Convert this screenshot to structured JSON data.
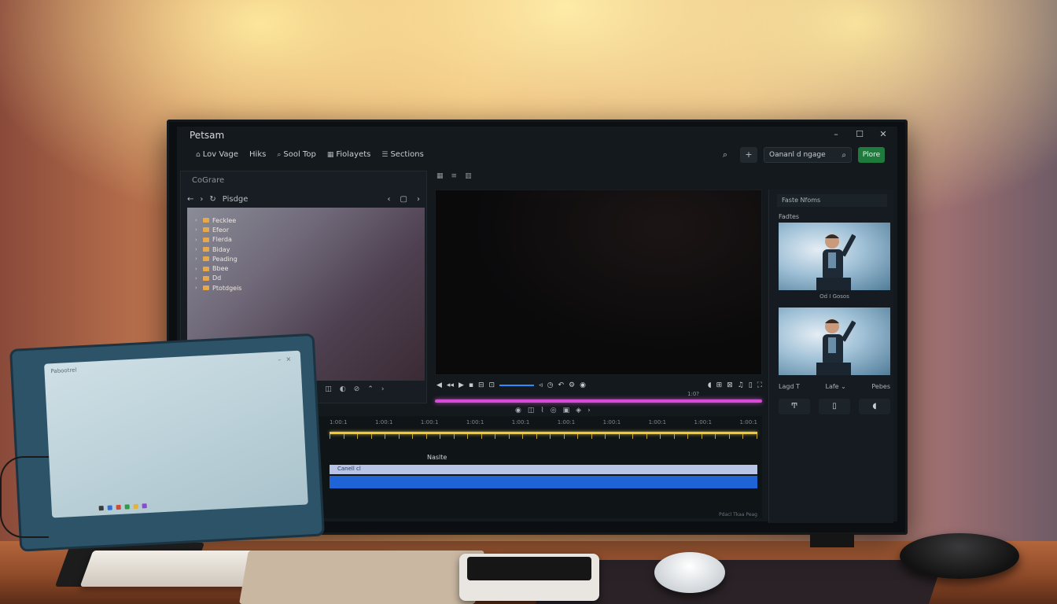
{
  "app": {
    "title": "Petsam",
    "window_controls": [
      "–",
      "☐",
      "✕"
    ]
  },
  "toolbar": {
    "menu": [
      {
        "icon": "home-icon",
        "glyph": "⌂",
        "label": "Lov Vage"
      },
      {
        "icon": "",
        "glyph": "",
        "label": "Hiks"
      },
      {
        "icon": "search-icon",
        "glyph": "⌕",
        "label": "Sool Top"
      },
      {
        "icon": "grid-icon",
        "glyph": "▦",
        "label": "Fiolayets"
      },
      {
        "icon": "sections-icon",
        "glyph": "☰",
        "label": "Sections"
      }
    ],
    "search_value": "Oananl d ngage",
    "primary_button": "Plore"
  },
  "left_panel": {
    "header": "CoGrare",
    "path": "Pisdge",
    "tree": [
      "Fecklee",
      "Efeor",
      "Flerda",
      "Biday",
      "Peading",
      "Bbee",
      "Dd",
      "Ptotdgeis"
    ]
  },
  "right_panel": {
    "header": "Faste Nfoms",
    "subheader": "Fadtes",
    "thumb1_caption": "Od I Gosos",
    "labels": [
      "Lagd T",
      "Lafe ⌄",
      "Pebes"
    ],
    "buttons": [
      "Ͳ",
      "▯",
      "◖"
    ]
  },
  "viewer": {
    "time_label": "1:0?"
  },
  "timeline": {
    "ruler": [
      "1:00:1",
      "1:00:1",
      "1:00:1",
      "1:00:1",
      "1:00:1",
      "1:00:1",
      "1:00:1",
      "1:00:1",
      "1:00:1",
      "1:00:1"
    ],
    "track_label": "Naslte",
    "clip_label": "Canell cl",
    "footer_right": "Pdacl Tkaa Peag"
  },
  "laptop": {
    "title": "Pabootrel"
  },
  "colors": {
    "accent_green": "#1f7a3d",
    "scrub_magenta": "#d84ad8",
    "track_yellow": "#f0c93a",
    "clip_blue": "#1f64d6"
  }
}
